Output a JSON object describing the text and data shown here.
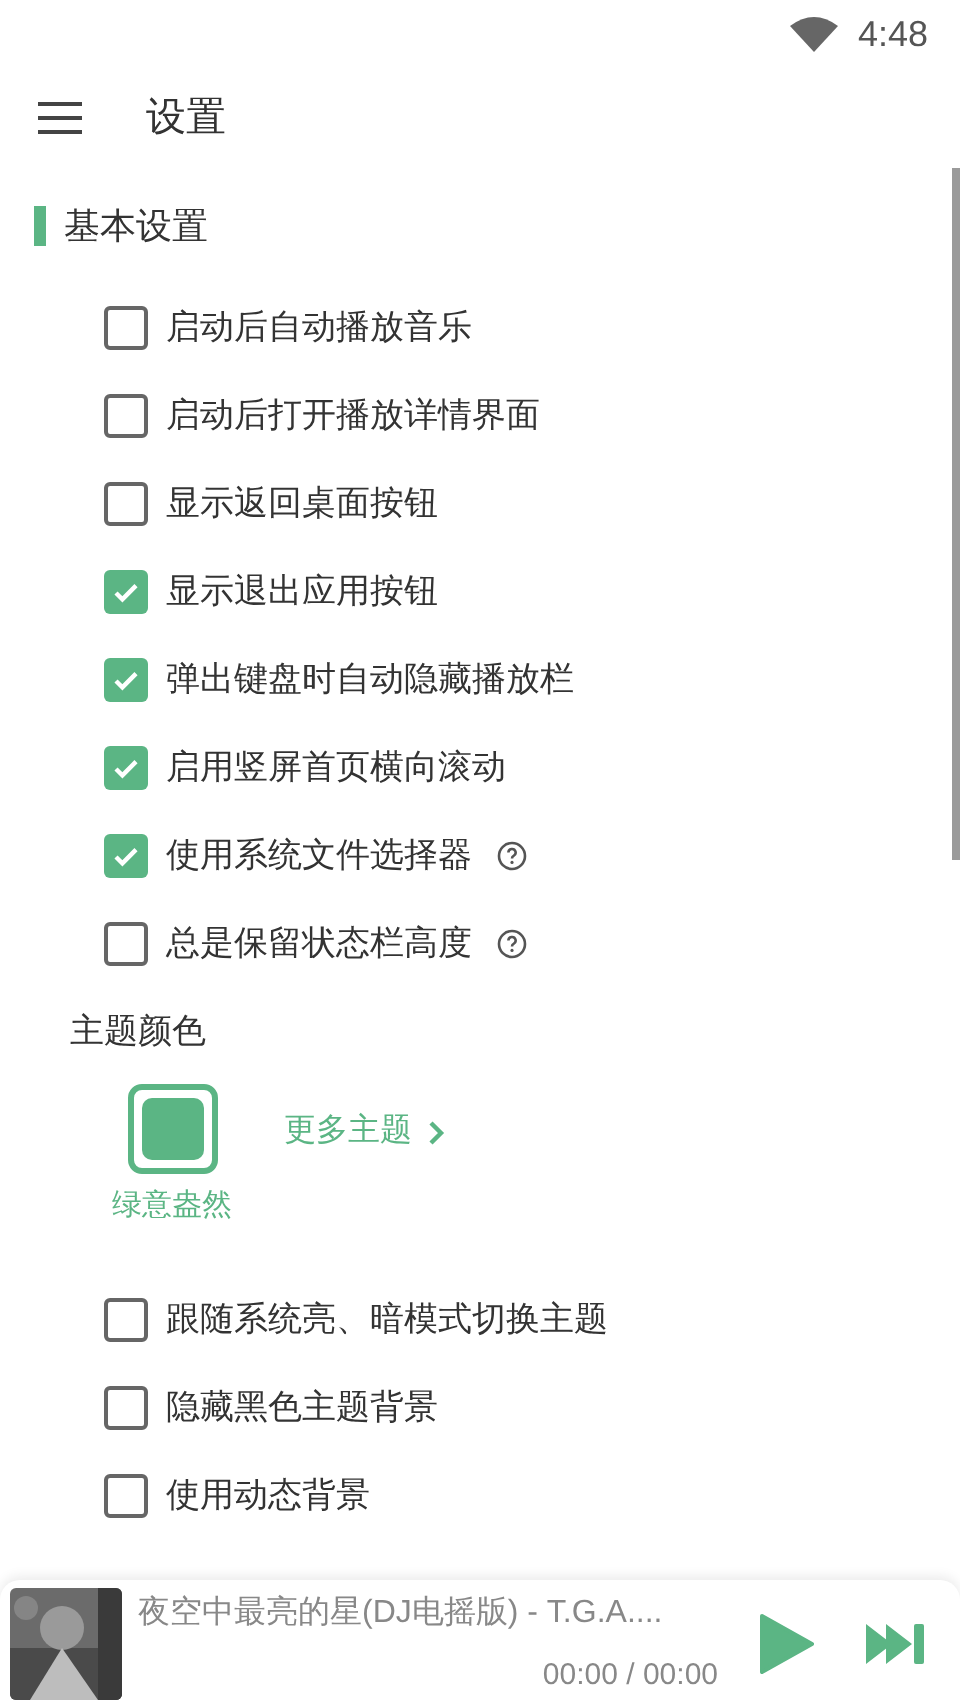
{
  "status_bar": {
    "time": "4:48"
  },
  "toolbar": {
    "title": "设置"
  },
  "section": {
    "title": "基本设置"
  },
  "options": [
    {
      "label": "启动后自动播放音乐",
      "checked": false,
      "help": false
    },
    {
      "label": "启动后打开播放详情界面",
      "checked": false,
      "help": false
    },
    {
      "label": "显示返回桌面按钮",
      "checked": false,
      "help": false
    },
    {
      "label": "显示退出应用按钮",
      "checked": true,
      "help": false
    },
    {
      "label": "弹出键盘时自动隐藏播放栏",
      "checked": true,
      "help": false
    },
    {
      "label": "启用竖屏首页横向滚动",
      "checked": true,
      "help": false
    },
    {
      "label": "使用系统文件选择器",
      "checked": true,
      "help": true
    },
    {
      "label": "总是保留状态栏高度",
      "checked": false,
      "help": true
    }
  ],
  "theme": {
    "heading": "主题颜色",
    "themes": [
      {
        "name": "绿意盎然",
        "color": "#5bb584",
        "selected": true
      }
    ],
    "more": "更多主题"
  },
  "options_2": [
    {
      "label": "跟随系统亮、暗模式切换主题",
      "checked": false
    },
    {
      "label": "隐藏黑色主题背景",
      "checked": false
    },
    {
      "label": "使用动态背景",
      "checked": false
    }
  ],
  "player": {
    "title": "夜空中最亮的星(DJ电摇版) - T.G.A....",
    "time": "00:00 / 00:00"
  }
}
